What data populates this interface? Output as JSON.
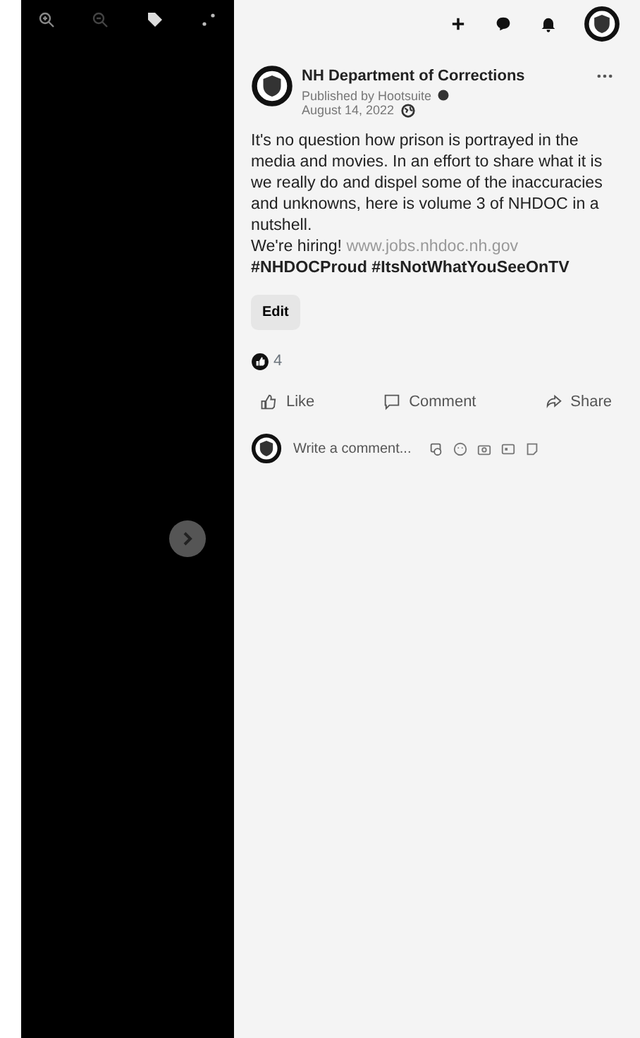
{
  "top_bar": {
    "buttons": [
      {
        "kind": "plus"
      },
      {
        "kind": "messenger"
      },
      {
        "kind": "bell"
      },
      {
        "kind": "avatar"
      }
    ]
  },
  "post": {
    "page_name": "NH Department of Corrections",
    "published_by": "Published by Hootsuite",
    "date": "August 14, 2022",
    "body": "It's no question how prison is portrayed in the media and movies. In an effort to share what it is we really do and dispel some of the inaccuracies and unknowns, here is volume 3 of NHDOC in a nutshell.",
    "hiring_text": "We're hiring!",
    "link": "www.jobs.nhdoc.nh.gov",
    "hashtags": "#NHDOCProud #ItsNotWhatYouSeeOnTV",
    "edit_button": "Edit",
    "reaction_count": "4",
    "actions": [
      {
        "kind": "like",
        "label": "Like"
      },
      {
        "kind": "comment",
        "label": "Comment"
      },
      {
        "kind": "share",
        "label": "Share"
      }
    ],
    "comment_placeholder": "Write a comment..."
  }
}
